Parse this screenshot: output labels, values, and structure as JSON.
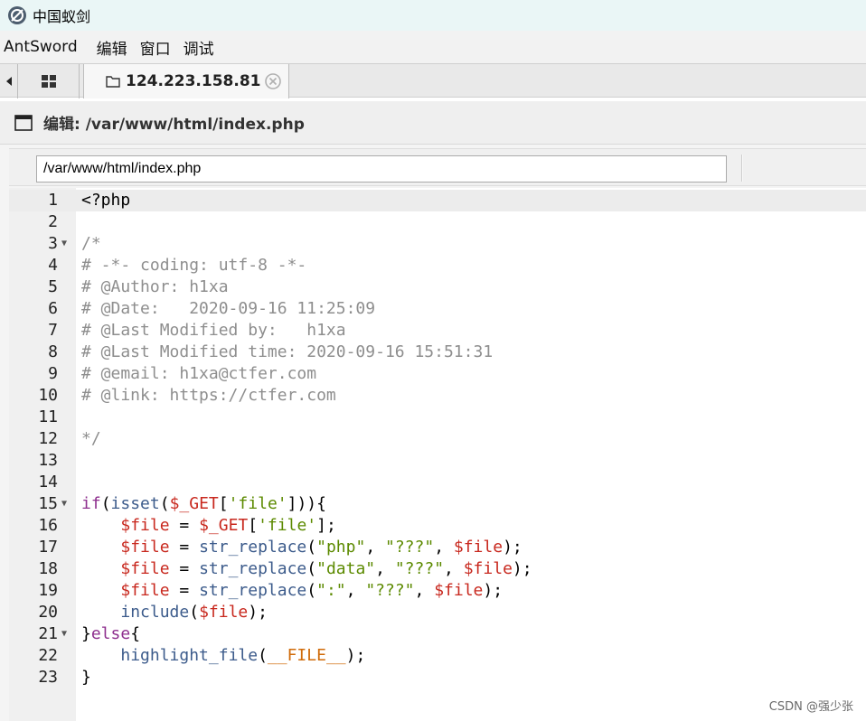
{
  "window": {
    "title": "中国蚁剑"
  },
  "menu": {
    "items": [
      "AntSword",
      "编辑",
      "窗口",
      "调试"
    ]
  },
  "tabs": {
    "active_label": "124.223.158.81"
  },
  "panel": {
    "title": "编辑: /var/www/html/index.php"
  },
  "path_input": {
    "value": "/var/www/html/index.php"
  },
  "editor": {
    "lines": [
      {
        "n": "1",
        "fold": false,
        "tokens": [
          {
            "t": "<?php",
            "c": "plain"
          }
        ]
      },
      {
        "n": "2",
        "fold": false,
        "tokens": []
      },
      {
        "n": "3",
        "fold": true,
        "tokens": [
          {
            "t": "/*",
            "c": "cmt"
          }
        ]
      },
      {
        "n": "4",
        "fold": false,
        "tokens": [
          {
            "t": "# -*- coding: utf-8 -*-",
            "c": "cmt"
          }
        ]
      },
      {
        "n": "5",
        "fold": false,
        "tokens": [
          {
            "t": "# @Author: h1xa",
            "c": "cmt"
          }
        ]
      },
      {
        "n": "6",
        "fold": false,
        "tokens": [
          {
            "t": "# @Date:   2020-09-16 11:25:09",
            "c": "cmt"
          }
        ]
      },
      {
        "n": "7",
        "fold": false,
        "tokens": [
          {
            "t": "# @Last Modified by:   h1xa",
            "c": "cmt"
          }
        ]
      },
      {
        "n": "8",
        "fold": false,
        "tokens": [
          {
            "t": "# @Last Modified time: 2020-09-16 15:51:31",
            "c": "cmt"
          }
        ]
      },
      {
        "n": "9",
        "fold": false,
        "tokens": [
          {
            "t": "# @email: h1xa@ctfer.com",
            "c": "cmt"
          }
        ]
      },
      {
        "n": "10",
        "fold": false,
        "tokens": [
          {
            "t": "# @link: https://ctfer.com",
            "c": "cmt"
          }
        ]
      },
      {
        "n": "11",
        "fold": false,
        "tokens": []
      },
      {
        "n": "12",
        "fold": false,
        "tokens": [
          {
            "t": "*/",
            "c": "cmt"
          }
        ]
      },
      {
        "n": "13",
        "fold": false,
        "tokens": []
      },
      {
        "n": "14",
        "fold": false,
        "tokens": []
      },
      {
        "n": "15",
        "fold": true,
        "tokens": [
          {
            "t": "if",
            "c": "kw"
          },
          {
            "t": "(",
            "c": "plain"
          },
          {
            "t": "isset",
            "c": "fn"
          },
          {
            "t": "(",
            "c": "plain"
          },
          {
            "t": "$_GET",
            "c": "var"
          },
          {
            "t": "[",
            "c": "plain"
          },
          {
            "t": "'file'",
            "c": "str"
          },
          {
            "t": "])){",
            "c": "plain"
          }
        ]
      },
      {
        "n": "16",
        "fold": false,
        "tokens": [
          {
            "t": "    ",
            "c": "plain"
          },
          {
            "t": "$file",
            "c": "var"
          },
          {
            "t": " = ",
            "c": "plain"
          },
          {
            "t": "$_GET",
            "c": "var"
          },
          {
            "t": "[",
            "c": "plain"
          },
          {
            "t": "'file'",
            "c": "str"
          },
          {
            "t": "];",
            "c": "plain"
          }
        ]
      },
      {
        "n": "17",
        "fold": false,
        "tokens": [
          {
            "t": "    ",
            "c": "plain"
          },
          {
            "t": "$file",
            "c": "var"
          },
          {
            "t": " = ",
            "c": "plain"
          },
          {
            "t": "str_replace",
            "c": "fn"
          },
          {
            "t": "(",
            "c": "plain"
          },
          {
            "t": "\"php\"",
            "c": "str"
          },
          {
            "t": ", ",
            "c": "plain"
          },
          {
            "t": "\"???\"",
            "c": "str"
          },
          {
            "t": ", ",
            "c": "plain"
          },
          {
            "t": "$file",
            "c": "var"
          },
          {
            "t": ");",
            "c": "plain"
          }
        ]
      },
      {
        "n": "18",
        "fold": false,
        "tokens": [
          {
            "t": "    ",
            "c": "plain"
          },
          {
            "t": "$file",
            "c": "var"
          },
          {
            "t": " = ",
            "c": "plain"
          },
          {
            "t": "str_replace",
            "c": "fn"
          },
          {
            "t": "(",
            "c": "plain"
          },
          {
            "t": "\"data\"",
            "c": "str"
          },
          {
            "t": ", ",
            "c": "plain"
          },
          {
            "t": "\"???\"",
            "c": "str"
          },
          {
            "t": ", ",
            "c": "plain"
          },
          {
            "t": "$file",
            "c": "var"
          },
          {
            "t": ");",
            "c": "plain"
          }
        ]
      },
      {
        "n": "19",
        "fold": false,
        "tokens": [
          {
            "t": "    ",
            "c": "plain"
          },
          {
            "t": "$file",
            "c": "var"
          },
          {
            "t": " = ",
            "c": "plain"
          },
          {
            "t": "str_replace",
            "c": "fn"
          },
          {
            "t": "(",
            "c": "plain"
          },
          {
            "t": "\":\"",
            "c": "str"
          },
          {
            "t": ", ",
            "c": "plain"
          },
          {
            "t": "\"???\"",
            "c": "str"
          },
          {
            "t": ", ",
            "c": "plain"
          },
          {
            "t": "$file",
            "c": "var"
          },
          {
            "t": ");",
            "c": "plain"
          }
        ]
      },
      {
        "n": "20",
        "fold": false,
        "tokens": [
          {
            "t": "    ",
            "c": "plain"
          },
          {
            "t": "include",
            "c": "fn"
          },
          {
            "t": "(",
            "c": "plain"
          },
          {
            "t": "$file",
            "c": "var"
          },
          {
            "t": ");",
            "c": "plain"
          }
        ]
      },
      {
        "n": "21",
        "fold": true,
        "tokens": [
          {
            "t": "}",
            "c": "plain"
          },
          {
            "t": "else",
            "c": "kw"
          },
          {
            "t": "{",
            "c": "plain"
          }
        ]
      },
      {
        "n": "22",
        "fold": false,
        "tokens": [
          {
            "t": "    ",
            "c": "plain"
          },
          {
            "t": "highlight_file",
            "c": "fn"
          },
          {
            "t": "(",
            "c": "plain"
          },
          {
            "t": "__FILE__",
            "c": "const"
          },
          {
            "t": ");",
            "c": "plain"
          }
        ]
      },
      {
        "n": "23",
        "fold": false,
        "tokens": [
          {
            "t": "}",
            "c": "plain"
          }
        ]
      }
    ]
  },
  "watermark": {
    "text": "CSDN @强少张"
  },
  "colors": {
    "comment": "#8e8e8e",
    "keyword": "#8e2f8e",
    "function": "#3c5b8b",
    "variable": "#c8281e",
    "string": "#5c8a00",
    "constant": "#d06b0a"
  }
}
